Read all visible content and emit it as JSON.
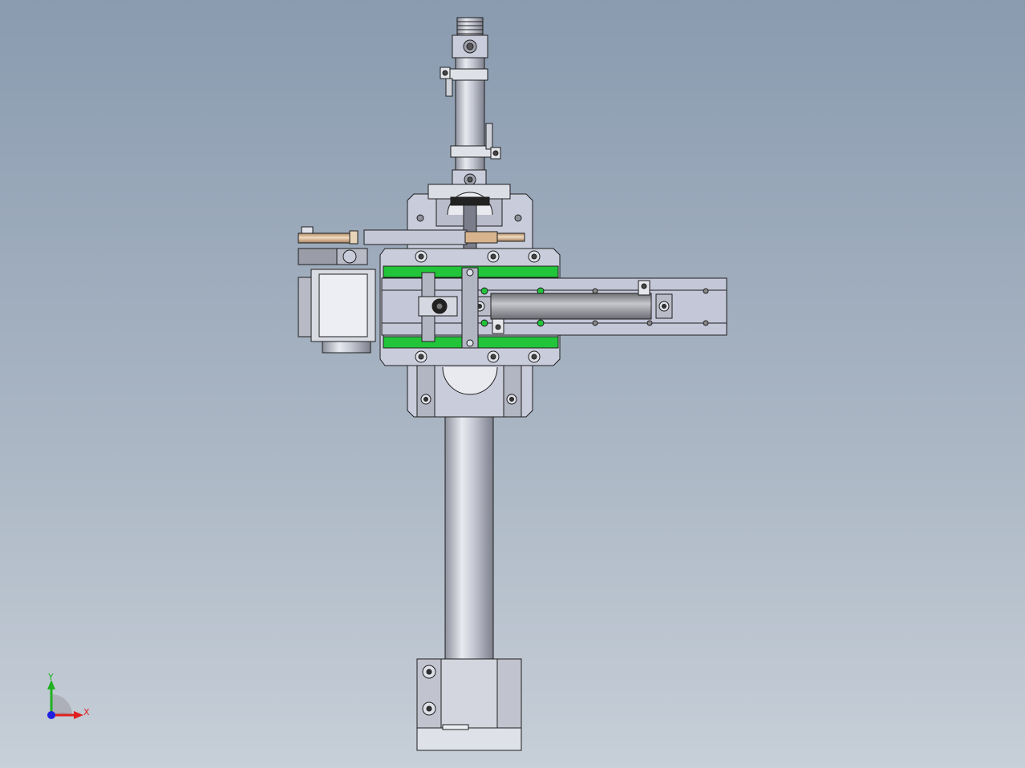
{
  "viewport": {
    "background_top": "#8a9bb0",
    "background_bottom": "#c7cfd8"
  },
  "model": {
    "part_fill": "#c9ccdb",
    "part_stroke": "#1e1e1e",
    "rail_color": "#22c53a",
    "rod_color": "#d8b48c",
    "cylinder_color": "#9a9a9e"
  },
  "triad": {
    "x_label": "X",
    "y_label": "Y",
    "x_color": "#e02020",
    "y_color": "#20b020",
    "z_color": "#2020e0"
  }
}
